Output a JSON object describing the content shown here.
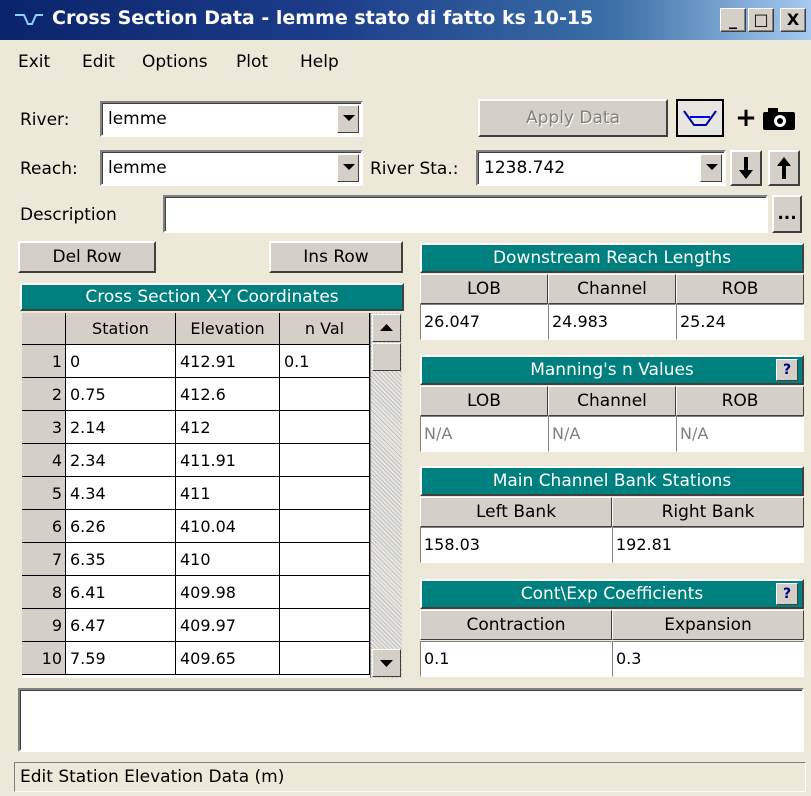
{
  "window": {
    "title": "Cross Section Data - lemme stato di fatto ks 10-15"
  },
  "menu": [
    "Exit",
    "Edit",
    "Options",
    "Plot",
    "Help"
  ],
  "river": {
    "label": "River:",
    "value": "lemme"
  },
  "reach": {
    "label": "Reach:",
    "value": "lemme"
  },
  "river_sta": {
    "label": "River Sta.:",
    "value": "1238.742"
  },
  "apply_data_label": "Apply Data",
  "description": {
    "label": "Description",
    "value": "",
    "browse_label": "..."
  },
  "buttons": {
    "del_row": "Del Row",
    "ins_row": "Ins Row"
  },
  "xy_table": {
    "title": "Cross Section X-Y Coordinates",
    "columns": [
      "Station",
      "Elevation",
      "n Val"
    ],
    "rows": [
      {
        "n": "1",
        "station": "0",
        "elevation": "412.91",
        "nval": "0.1"
      },
      {
        "n": "2",
        "station": "0.75",
        "elevation": "412.6",
        "nval": ""
      },
      {
        "n": "3",
        "station": "2.14",
        "elevation": "412",
        "nval": ""
      },
      {
        "n": "4",
        "station": "2.34",
        "elevation": "411.91",
        "nval": ""
      },
      {
        "n": "5",
        "station": "4.34",
        "elevation": "411",
        "nval": ""
      },
      {
        "n": "6",
        "station": "6.26",
        "elevation": "410.04",
        "nval": ""
      },
      {
        "n": "7",
        "station": "6.35",
        "elevation": "410",
        "nval": ""
      },
      {
        "n": "8",
        "station": "6.41",
        "elevation": "409.98",
        "nval": ""
      },
      {
        "n": "9",
        "station": "6.47",
        "elevation": "409.97",
        "nval": ""
      },
      {
        "n": "10",
        "station": "7.59",
        "elevation": "409.65",
        "nval": ""
      }
    ]
  },
  "downstream": {
    "title": "Downstream Reach Lengths",
    "cols": [
      "LOB",
      "Channel",
      "ROB"
    ],
    "values": [
      "26.047",
      "24.983",
      "25.24"
    ]
  },
  "mannings": {
    "title": "Manning's n Values",
    "cols": [
      "LOB",
      "Channel",
      "ROB"
    ],
    "values": [
      "N/A",
      "N/A",
      "N/A"
    ],
    "help": "?"
  },
  "bank_stations": {
    "title": "Main Channel Bank Stations",
    "cols": [
      "Left Bank",
      "Right Bank"
    ],
    "values": [
      "158.03",
      "192.81"
    ]
  },
  "coefficients": {
    "title": "Cont\\Exp  Coefficients",
    "cols": [
      "Contraction",
      "Expansion"
    ],
    "values": [
      "0.1",
      "0.3"
    ],
    "help": "?"
  },
  "status": "Edit Station Elevation Data (m)",
  "caption_buttons": {
    "min": "_",
    "max": "□",
    "close": "X"
  },
  "colors": {
    "teal": "#007f7f",
    "titlebar": "#0a246a",
    "face": "#d4d0c8"
  }
}
